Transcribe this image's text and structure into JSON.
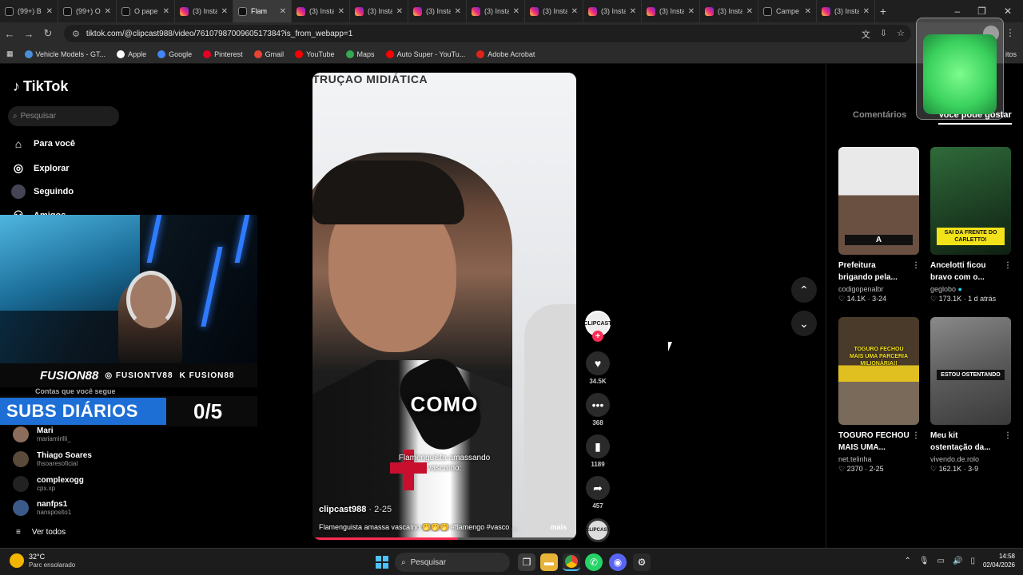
{
  "browser": {
    "tabs": [
      {
        "label": "(99+) B",
        "icon": "tiktok-icon"
      },
      {
        "label": "(99+) O",
        "icon": "tiktok-icon"
      },
      {
        "label": "O pape",
        "icon": "tiktok-icon"
      },
      {
        "label": "(3) Insta",
        "icon": "instagram-icon"
      },
      {
        "label": "Flam",
        "icon": "tiktok-icon",
        "active": true
      },
      {
        "label": "(3) Insta",
        "icon": "instagram-icon"
      },
      {
        "label": "(3) Insta",
        "icon": "instagram-icon"
      },
      {
        "label": "(3) Insta",
        "icon": "instagram-icon"
      },
      {
        "label": "(3) Insta",
        "icon": "instagram-icon"
      },
      {
        "label": "(3) Insta",
        "icon": "instagram-icon"
      },
      {
        "label": "(3) Insta",
        "icon": "instagram-icon"
      },
      {
        "label": "(3) Insta",
        "icon": "instagram-icon"
      },
      {
        "label": "(3) Insta",
        "icon": "instagram-icon"
      },
      {
        "label": "Campe",
        "icon": "tiktok-icon"
      },
      {
        "label": "(3) Insta",
        "icon": "instagram-icon"
      }
    ],
    "url": "tiktok.com/@clipcast988/video/7610798700960517384?is_from_webapp=1",
    "bookmarks": [
      "Vehicle Models - GT...",
      "Apple",
      "Google",
      "Pinterest",
      "Gmail",
      "YouTube",
      "Maps",
      "Auto Super - YouTu...",
      "Adobe Acrobat"
    ],
    "bookmarks_right": "itos"
  },
  "sidebar": {
    "logo": "TikTok",
    "search_placeholder": "Pesquisar",
    "nav": [
      "Para você",
      "Explorar",
      "Seguindo",
      "Amigos"
    ],
    "following": [
      {
        "name": "Mari",
        "handle": "mariamirilli_"
      },
      {
        "name": "Thiago Soares",
        "handle": "thsoaresoficial"
      },
      {
        "name": "complexogg",
        "handle": "cpx.xp"
      },
      {
        "name": "nanfps1",
        "handle": "nansposito1"
      }
    ],
    "see_all": "Ver todos",
    "following_header_partial": "Contas que você segue"
  },
  "stream_overlay": {
    "name": "FUSION88",
    "instagram": "FUSIONTV88",
    "kick": "FUSION88",
    "subs_label": "SUBS DIÁRIOS",
    "subs_count": "0/5"
  },
  "video": {
    "top_text": "TRUÇAO MIDIÁTICA",
    "big_word": "COMO",
    "subtitle_line1": "Flamenguista amassando",
    "subtitle_line2": "vascaíno:",
    "author": "clipcast988",
    "date": "· 2-25",
    "caption": "Flamenguista amassa vascaíno 🤭🤭🤭 #flamengo #vasco ...",
    "more": "mais",
    "creator_badge": "CLIPCAST",
    "progress": 0.55,
    "likes": "34.5K",
    "comments": "368",
    "saves": "1189",
    "shares": "457"
  },
  "right_panel": {
    "tabs": [
      "Comentários",
      "Você pode gostar"
    ],
    "cards": [
      {
        "title1": "Prefeitura",
        "title2": "brigando pela...",
        "author": "codigopenalbr",
        "likes": "14.1K",
        "date": "3-24",
        "thumb_text": "A",
        "verified": false
      },
      {
        "title1": "Ancelotti ficou",
        "title2": "bravo com o...",
        "author": "geglobo",
        "likes": "173.1K",
        "date": "1 d atrás",
        "thumb_text": "SAI DA FRENTE DO CARLETTO!",
        "verified": true
      },
      {
        "title1": "TOGURO FECHOU",
        "title2": "MAIS UMA...",
        "author": "net.telinha",
        "likes": "2370",
        "date": "2-25",
        "thumb_text": "TOGURO FECHOU MAIS UMA PARCERIA MILIONÁRIA!!",
        "verified": false
      },
      {
        "title1": "Meu kit",
        "title2": "ostentação da...",
        "author": "vivendo.de.rolo",
        "likes": "162.1K",
        "date": "3-9",
        "thumb_text": "ESTOU OSTENTANDO",
        "verified": false
      }
    ]
  },
  "taskbar": {
    "temperature": "32°C",
    "condition": "Parc ensolarado",
    "search": "Pesquisar",
    "time": "14:58",
    "date": "02/04/2026"
  },
  "colors": {
    "accent": "#fe2c55",
    "subs_blue": "#1d6fd6",
    "windows_blue": "#4cc2ff"
  }
}
